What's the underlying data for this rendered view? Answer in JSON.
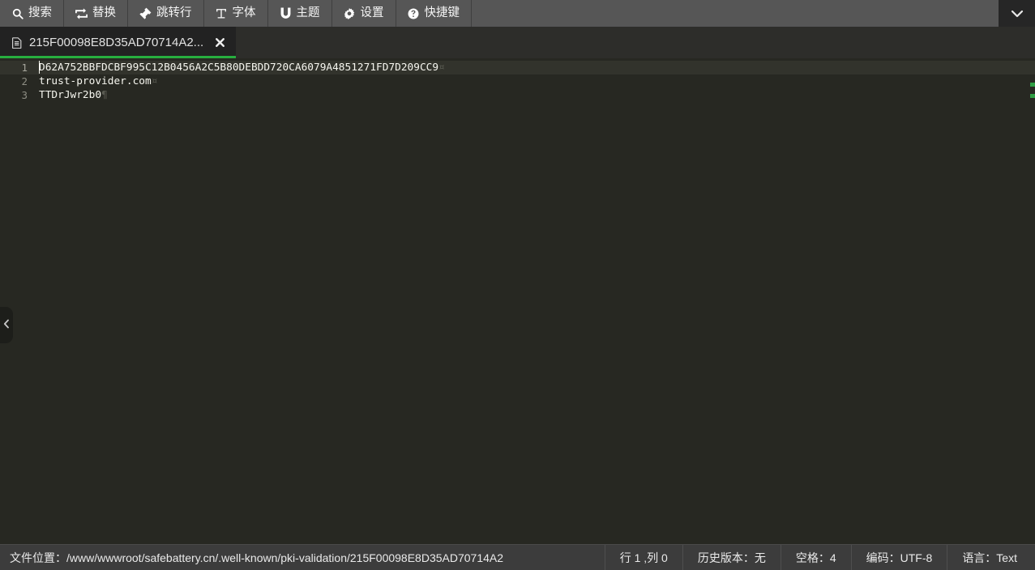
{
  "toolbar": {
    "buttons": [
      {
        "icon": "search-icon",
        "label": "搜索"
      },
      {
        "icon": "replace-icon",
        "label": "替换"
      },
      {
        "icon": "goto-line-icon",
        "label": "跳转行"
      },
      {
        "icon": "font-icon",
        "label": "字体"
      },
      {
        "icon": "theme-icon",
        "label": "主题"
      },
      {
        "icon": "settings-icon",
        "label": "设置"
      },
      {
        "icon": "shortcut-icon",
        "label": "快捷键"
      }
    ],
    "overflow_icon": "chevron-down-icon"
  },
  "tab": {
    "icon": "file-icon",
    "title": "215F00098E8D35AD70714A2...",
    "close_icon": "close-icon",
    "accent_color": "#27ae3f"
  },
  "sidebar": {
    "handle_icon": "chevron-left-icon"
  },
  "editor": {
    "background": "#272822",
    "line_numbers": [
      "1",
      "2",
      "3"
    ],
    "lines": [
      {
        "text": "D62A752BBFDCBF995C12B0456A2C5B80DEBDD720CA6079A4851271FD7D209CC9",
        "eol": "¤"
      },
      {
        "text": "trust-provider.com",
        "eol": "¤"
      },
      {
        "text": "TTDrJwr2b0",
        "eol": "¶"
      }
    ],
    "active_line_index": 0
  },
  "statusbar": {
    "file_location_label": "文件位置：",
    "file_location_value": "/www/wwwroot/safebattery.cn/.well-known/pki-validation/215F00098E8D35AD70714A2",
    "segments": [
      {
        "name": "cursor-position",
        "text": "行 1 ,列 0"
      },
      {
        "name": "history-version",
        "text": "历史版本：无"
      },
      {
        "name": "indent-size",
        "text": "空格：4"
      },
      {
        "name": "encoding",
        "text": "编码：UTF-8"
      },
      {
        "name": "language",
        "text": "语言：Text"
      }
    ]
  }
}
